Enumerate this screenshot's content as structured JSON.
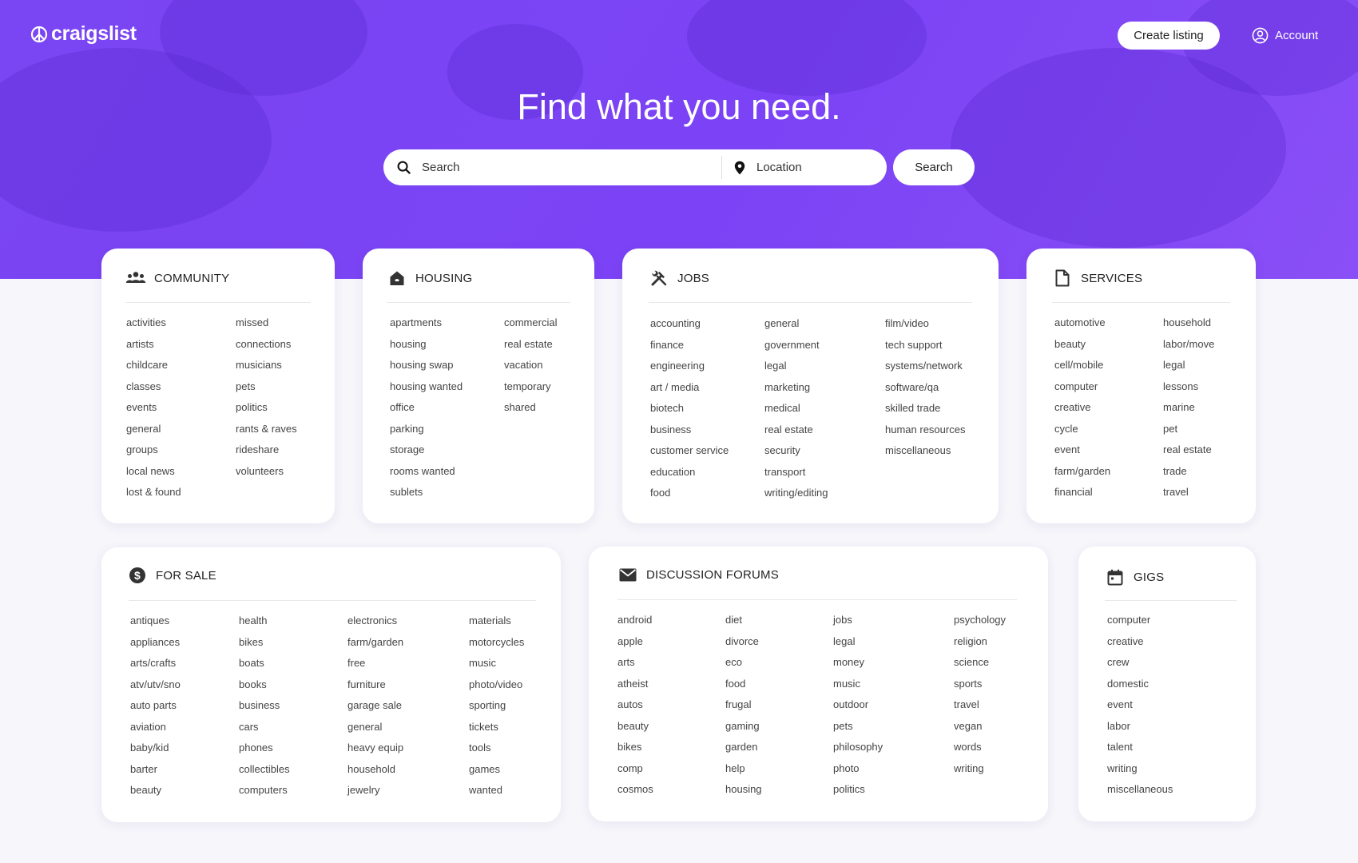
{
  "brand": {
    "name": "craigslist"
  },
  "header": {
    "create_label": "Create listing",
    "account_label": "Account"
  },
  "hero": {
    "headline": "Find what you need."
  },
  "search": {
    "query_placeholder": "Search",
    "location_placeholder": "Location",
    "button_label": "Search"
  },
  "colors": {
    "hero": "#7b43f5",
    "card": "#ffffff",
    "page": "#f7f6fb"
  },
  "categories": {
    "community": {
      "title": "COMMUNITY",
      "icon": "community-icon",
      "columns": [
        [
          "activities",
          "artists",
          "childcare",
          "classes",
          "events",
          "general",
          "groups",
          "local news",
          "lost & found"
        ],
        [
          "missed",
          "connections",
          "musicians",
          "pets",
          "politics",
          "rants & raves",
          "rideshare",
          "volunteers"
        ]
      ]
    },
    "housing": {
      "title": "HOUSING",
      "icon": "house-icon",
      "columns": [
        [
          "apartments",
          "housing",
          "housing swap",
          "housing wanted",
          "office",
          "parking",
          "storage",
          "rooms wanted",
          "sublets"
        ],
        [
          "commercial",
          "real estate",
          "vacation",
          "temporary",
          "shared"
        ]
      ]
    },
    "jobs": {
      "title": "JOBS",
      "icon": "tools-icon",
      "columns": [
        [
          "accounting",
          "finance",
          "engineering",
          "art / media",
          "biotech",
          "business",
          "customer service",
          "education",
          "food"
        ],
        [
          "general",
          "government",
          "legal",
          "marketing",
          "medical",
          "real estate",
          "security",
          "transport",
          "writing/editing"
        ],
        [
          "film/video",
          "tech support",
          "systems/network",
          "software/qa",
          "skilled trade",
          "human resources",
          "miscellaneous"
        ]
      ]
    },
    "services": {
      "title": "SERVICES",
      "icon": "document-icon",
      "columns": [
        [
          "automotive",
          "beauty",
          "cell/mobile",
          "computer",
          "creative",
          "cycle",
          "event",
          "farm/garden",
          "financial"
        ],
        [
          "household",
          "labor/move",
          "legal",
          "lessons",
          "marine",
          "pet",
          "real estate",
          "trade",
          "travel"
        ]
      ]
    },
    "for_sale": {
      "title": "FOR SALE",
      "icon": "dollar-icon",
      "columns": [
        [
          "antiques",
          "appliances",
          "arts/crafts",
          "atv/utv/sno",
          "auto parts",
          "aviation",
          "baby/kid",
          "barter",
          "beauty"
        ],
        [
          "health",
          "bikes",
          "boats",
          "books",
          "business",
          "cars",
          "phones",
          "collectibles",
          "computers"
        ],
        [
          "electronics",
          "farm/garden",
          "free",
          "furniture",
          "garage sale",
          "general",
          "heavy equip",
          "household",
          "jewelry"
        ],
        [
          "materials",
          "motorcycles",
          "music",
          "photo/video",
          "sporting",
          "tickets",
          "tools",
          "games",
          "wanted"
        ]
      ]
    },
    "forums": {
      "title": "DISCUSSION FORUMS",
      "icon": "envelope-icon",
      "columns": [
        [
          "android",
          "apple",
          "arts",
          "atheist",
          "autos",
          "beauty",
          "bikes",
          "comp",
          "cosmos"
        ],
        [
          "diet",
          "divorce",
          "eco",
          "food",
          "frugal",
          "gaming",
          "garden",
          "help",
          "housing"
        ],
        [
          "jobs",
          "legal",
          "money",
          "music",
          "outdoor",
          "pets",
          "philosophy",
          "photo",
          "politics"
        ],
        [
          "psychology",
          "religion",
          "science",
          "sports",
          "travel",
          "vegan",
          "words",
          "writing"
        ]
      ]
    },
    "gigs": {
      "title": "GIGS",
      "icon": "calendar-icon",
      "columns": [
        [
          "computer",
          "creative",
          "crew",
          "domestic",
          "event",
          "labor",
          "talent",
          "writing",
          "miscellaneous"
        ]
      ]
    }
  }
}
